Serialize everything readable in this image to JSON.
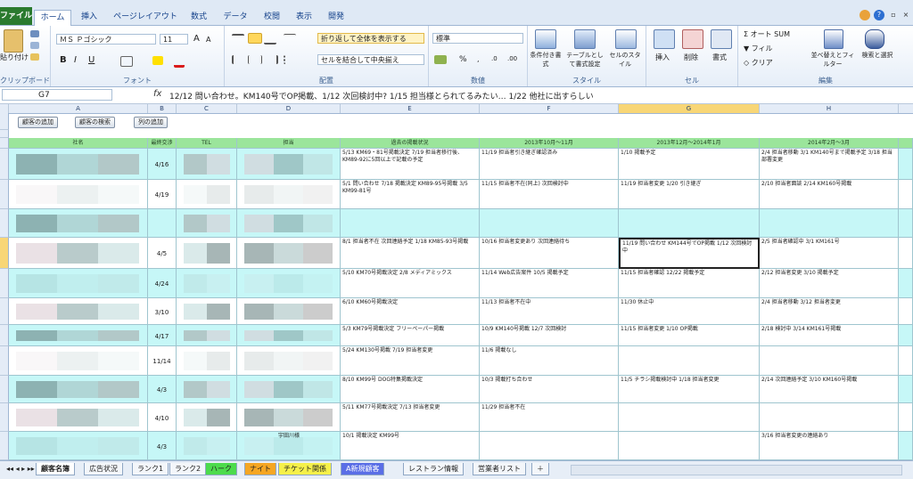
{
  "ribbon_tabs": [
    "ファイル",
    "ホーム",
    "挿入",
    "ページレイアウト",
    "数式",
    "データ",
    "校閲",
    "表示",
    "開発"
  ],
  "ribbon": {
    "clipboard": {
      "label": "クリップボード",
      "paste": "貼り付け"
    },
    "font": {
      "label": "フォント",
      "name": "ＭＳ Ｐゴシック",
      "size": "11",
      "bold": "B",
      "italic": "I",
      "underline": "U"
    },
    "alignment": {
      "label": "配置",
      "wrap": "折り返して全体を表示する",
      "merge": "セルを結合して中央揃え"
    },
    "number": {
      "label": "数値",
      "format": "標準",
      "percent": "%"
    },
    "styles": {
      "label": "スタイル",
      "conditional": "条件付き書式",
      "table": "テーブルとして書式設定",
      "cell": "セルのスタイル"
    },
    "cells": {
      "label": "セル",
      "insert": "挿入",
      "delete": "削除",
      "format": "書式"
    },
    "editing": {
      "label": "編集",
      "autosum": "オート SUM",
      "fill": "フィル",
      "clear": "クリア",
      "sort": "並べ替えとフィルター",
      "find": "検索と選択"
    }
  },
  "formula_bar": {
    "name_box": "G7",
    "fx": "fx",
    "content": "12/12 問い合わせ。KM140号でOP掲載、1/12 次回検討中? 1/15 担当様とられてるみたい… 1/22 他社に出すらしい"
  },
  "columns": [
    "A",
    "B",
    "C",
    "D",
    "E",
    "F",
    "G",
    "H"
  ],
  "buttons": [
    "顧客の追加",
    "顧客の検索",
    "列の追加"
  ],
  "table_headers": [
    "社名",
    "最終交渉",
    "TEL",
    "担当",
    "過去の掲載状況",
    "2013年10月〜11月",
    "2013年12月〜2014年1月",
    "2014年2月〜3月"
  ],
  "rows": [
    {
      "date": "4/16",
      "e": "5/13 KM69・81号掲載決定 7/19 担当者移行後、KM89-92に5回以上で記載の予定",
      "f": "11/19 担当者引き継ぎ確認済み",
      "g": "1/10 掲載予定",
      "h": "2/4 担当者移動 3/1 KM140号まで掲載予定 3/18 担当部署変更"
    },
    {
      "date": "4/19",
      "e": "5/1 問い合わせ 7/18 掲載決定 KM89-95号掲載 3/5 KM99-81号",
      "f": "11/15 担当者不在(同上) 次回検討中",
      "g": "11/19 担当者変更 1/20 引き継ぎ",
      "h": "2/10 担当者面談 2/14 KM160号掲載"
    },
    {
      "date": "",
      "e": "",
      "f": "",
      "g": "",
      "h": ""
    },
    {
      "date": "4/5",
      "e": "8/1 担当者不在 次回連絡予定 1/18 KM85-93号掲載",
      "f": "10/16 担当者変更あり 次回連絡待ち",
      "g": "11/19 問い合わせ KM144号でOP掲載 1/12 次回検討中",
      "h": "2/5 担当者確認中 3/1 KM161号"
    },
    {
      "date": "4/24",
      "e": "5/10 KM70号掲載決定 2/8 メディアミックス",
      "f": "11/14 Web広告案件 10/5 掲載予定",
      "g": "11/15 担当者確認 12/22 掲載予定",
      "h": "2/12 担当者変更 3/10 掲載予定"
    },
    {
      "date": "3/10",
      "e": "6/10 KM60号掲載決定",
      "f": "11/13 担当者不在中",
      "g": "11/30 休止中",
      "h": "2/4 担当者移動 3/12 担当者変更"
    },
    {
      "date": "4/17",
      "e": "5/3 KM79号掲載決定 フリーペーパー掲載",
      "f": "10/9 KM140号掲載 12/7 次回検討",
      "g": "11/15 担当者変更 1/10 OP掲載",
      "h": "2/18 検討中 3/14 KM161号掲載"
    },
    {
      "date": "11/14",
      "e": "5/24 KM130号掲載 7/19 担当者変更",
      "f": "11/6 掲載なし",
      "g": "",
      "h": ""
    },
    {
      "date": "4/3",
      "e": "8/10 KM99号 DOG特集掲載決定",
      "f": "10/3 掲載打ち合わせ",
      "g": "11/5 チラシ掲載検討中 1/18 担当者変更",
      "h": "2/14 次回連絡予定 3/10 KM160号掲載"
    },
    {
      "date": "4/10",
      "e": "5/11 KM77号掲載決定 7/13 担当者変更",
      "f": "11/29 担当者不在",
      "g": "",
      "h": ""
    },
    {
      "date": "4/3",
      "e": "10/1 掲載決定 KM99号",
      "f": "",
      "g": "",
      "h": "3/16 担当者変更の連絡あり"
    }
  ],
  "special_contact": "宇田川様",
  "sheet_tabs": [
    "顧客名簿",
    "広告状況",
    "ランク1",
    "ランク2",
    "ハーク",
    "ナイト",
    "チケット関係",
    "A新規顧客",
    "レストラン情報",
    "営業者リスト"
  ]
}
